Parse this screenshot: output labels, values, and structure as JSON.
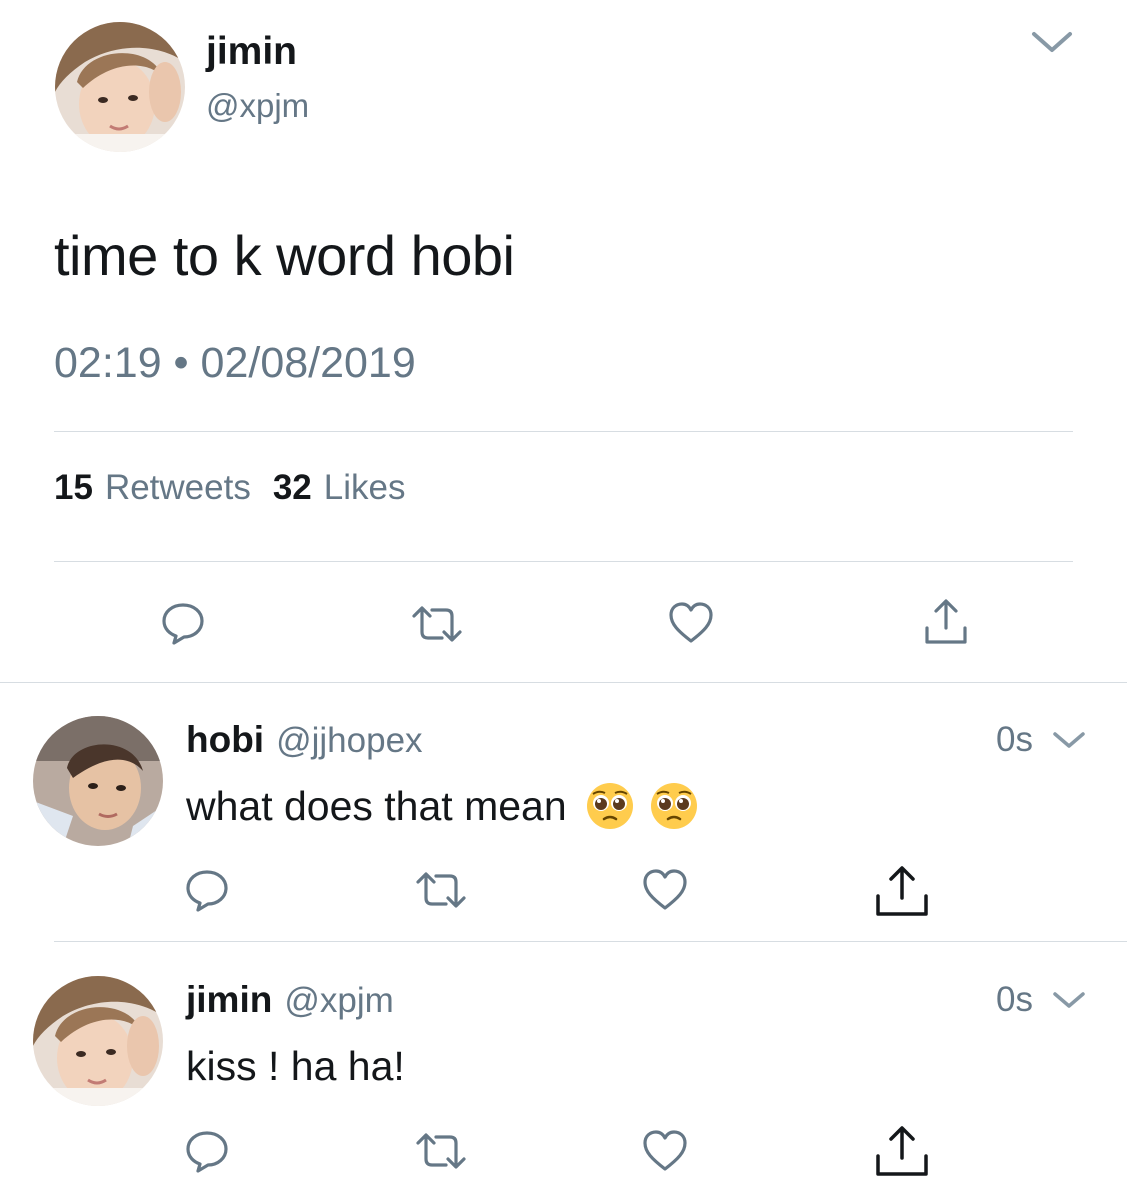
{
  "main_tweet": {
    "author_name": "jimin",
    "author_handle": "@xpjm",
    "text": "time to k word hobi",
    "timestamp": "02:19 • 02/08/2019",
    "retweets_count": "15",
    "retweets_label": "Retweets",
    "likes_count": "32",
    "likes_label": "Likes",
    "actions": [
      "reply-icon",
      "retweet-icon",
      "like-icon",
      "share-icon"
    ]
  },
  "replies": [
    {
      "author_name": "hobi",
      "author_handle": "@jjhopex",
      "time": "0s",
      "text": "what does that mean",
      "emojis": [
        "pleading-face-emoji",
        "pleading-face-emoji"
      ]
    },
    {
      "author_name": "jimin",
      "author_handle": "@xpjm",
      "time": "0s",
      "text": "kiss ! ha ha!"
    }
  ],
  "colors": {
    "text_primary": "#14171a",
    "text_secondary": "#657786",
    "icon_gray": "#657786",
    "divider": "#d7dde2"
  }
}
